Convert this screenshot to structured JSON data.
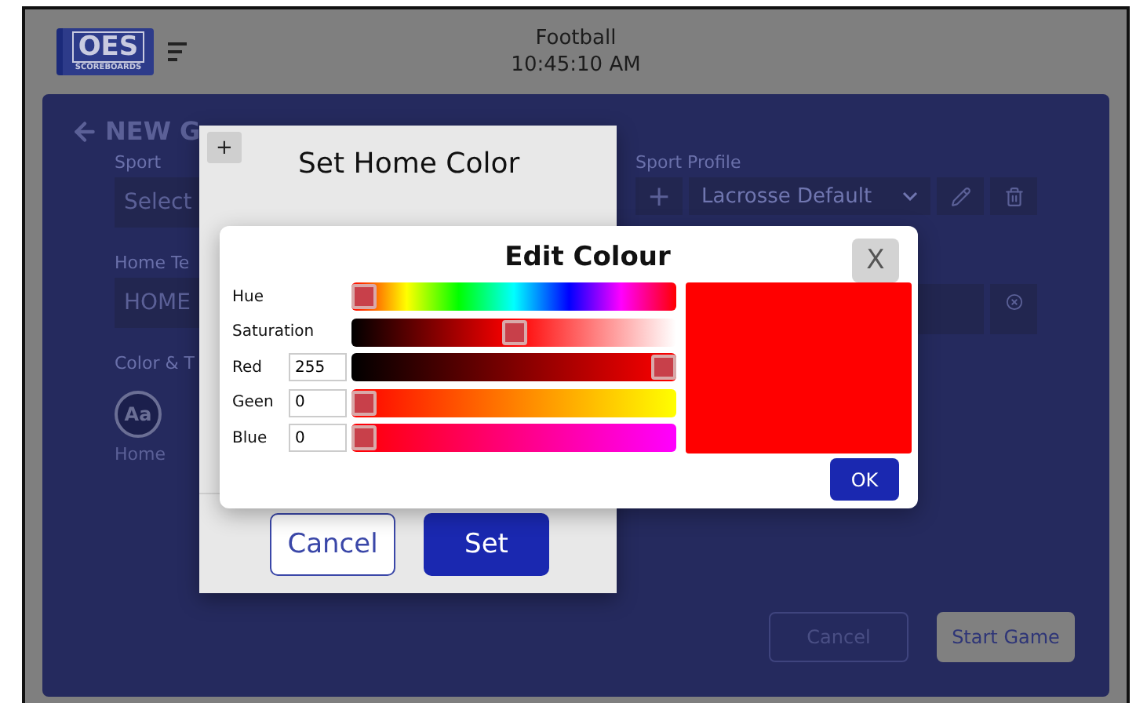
{
  "header": {
    "logo": {
      "mark": "OES",
      "subtitle": "SCOREBOARDS"
    },
    "sport": "Football",
    "time": "10:45:10 AM"
  },
  "page": {
    "title": "NEW G",
    "left": {
      "sport_label": "Sport",
      "sport_value": "Select",
      "team_label": "Home Te",
      "team_value": "HOME",
      "color_label": "Color & T",
      "swatch_text": "Aa",
      "swatch_label": "Home"
    },
    "right": {
      "profile_label": "Sport Profile",
      "add": "+",
      "profile_value": "Lacrosse Default"
    },
    "buttons": [
      {
        "label": "Cancel",
        "kind": "outline"
      },
      {
        "label": "Start Game",
        "kind": "filled"
      }
    ]
  },
  "set_color_dialog": {
    "add": "+",
    "title": "Set Home Color",
    "buttons": [
      {
        "label": "Cancel",
        "kind": "outline"
      },
      {
        "label": "Set",
        "kind": "filled"
      }
    ]
  },
  "edit_dialog": {
    "title": "Edit Colour",
    "close": "X",
    "ok": "OK",
    "sliders": [
      {
        "label": "Hue",
        "kind": "hue",
        "level": 0
      },
      {
        "label": "Saturation",
        "kind": "lightness",
        "level": 0.5
      },
      {
        "label": "Red",
        "kind": "red",
        "value": "255",
        "level": 1
      },
      {
        "label": "Geen",
        "kind": "green",
        "value": "0",
        "level": 0
      },
      {
        "label": "Blue",
        "kind": "blue",
        "value": "0",
        "level": 0
      }
    ]
  }
}
